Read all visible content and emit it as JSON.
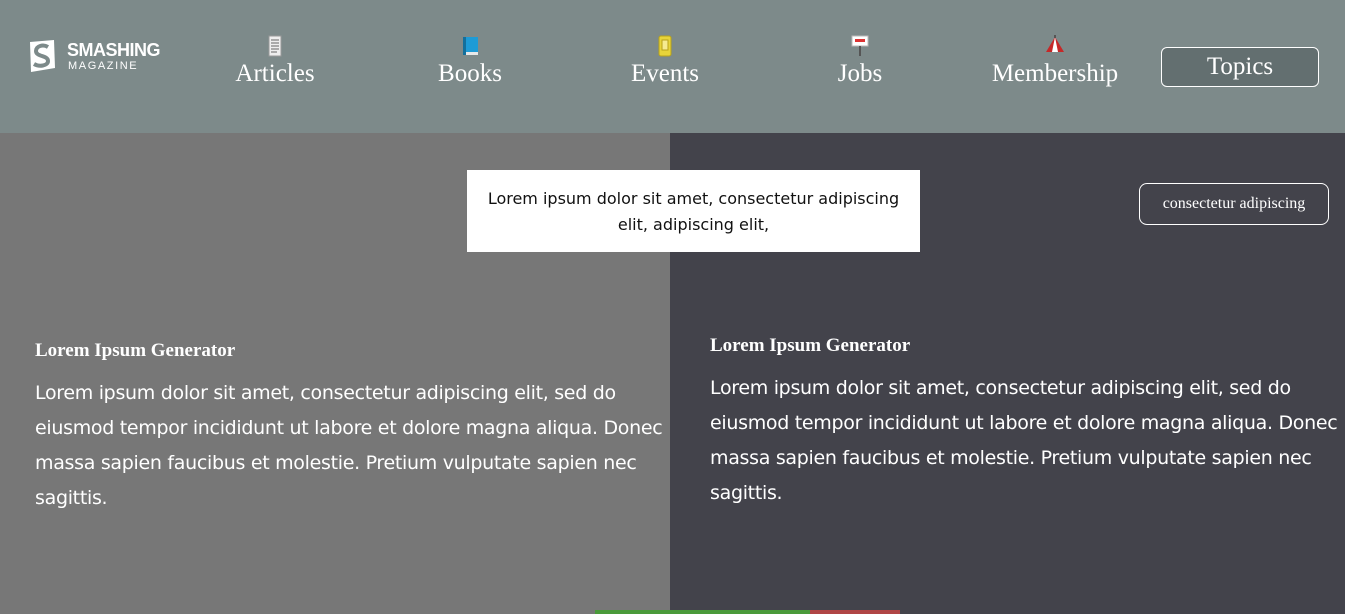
{
  "brand": {
    "name": "SMASHING",
    "tagline": "MAGAZINE"
  },
  "nav": [
    {
      "label": "Articles",
      "icon": "article-icon"
    },
    {
      "label": "Books",
      "icon": "book-icon"
    },
    {
      "label": "Events",
      "icon": "events-icon"
    },
    {
      "label": "Jobs",
      "icon": "jobs-sign-icon"
    },
    {
      "label": "Membership",
      "icon": "membership-tent-icon"
    }
  ],
  "topics_button": "Topics",
  "tooltip_text": "Lorem ipsum dolor sit amet, consectetur adipiscing elit, adipiscing elit,",
  "pill_button": "consectetur adipiscing",
  "left_article": {
    "title": "Lorem Ipsum Generator",
    "body": "Lorem ipsum dolor sit amet, consectetur adipiscing elit, sed do eiusmod tempor incididunt ut labore et dolore magna aliqua. Donec massa sapien faucibus et molestie. Pretium vulputate sapien nec sagittis."
  },
  "right_article": {
    "title": "Lorem Ipsum Generator",
    "body": "Lorem ipsum dolor sit amet, consectetur adipiscing elit, sed do eiusmod tempor incididunt ut labore et dolore magna aliqua. Donec massa sapien faucibus et molestie. Pretium vulputate sapien nec sagittis."
  },
  "colors": {
    "header_bg": "#7d8a8a",
    "left_panel_bg": "#777777",
    "right_panel_bg": "#43434b",
    "topics_bg": "#636f70"
  }
}
